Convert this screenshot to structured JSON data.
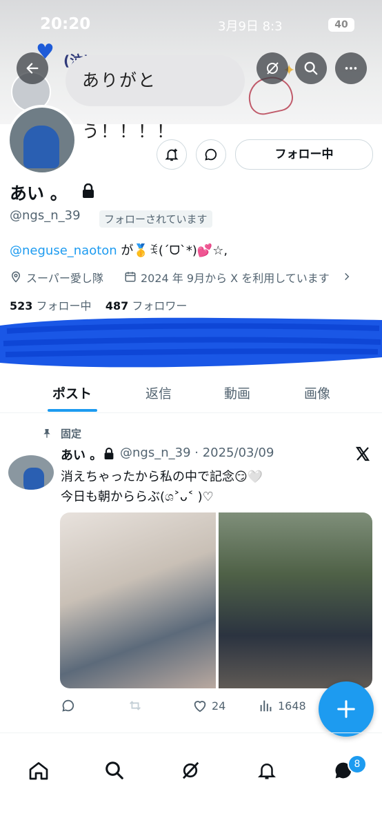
{
  "status_bar": {
    "time": "20:20",
    "date": "3月9日 8:3",
    "battery": "40"
  },
  "banner": {
    "bubble_text": "ありがとう！！！！",
    "crying_text": "(泣)"
  },
  "profile": {
    "follow_button": "フォロー中",
    "display_name": "あい 。",
    "handle": "@ngs_n_39",
    "follows_you": "フォローされています",
    "bio_mention": "@neguse_naoton",
    "bio_rest": " が🥇ꉂ(ˊᗜˋ*)💕☆,",
    "location": "スーパー愛し隊",
    "joined": "2024 年 9月から X を利用しています",
    "following_count": "523",
    "following_label": "フォロー中",
    "followers_count": "487",
    "followers_label": "フォロワー"
  },
  "tabs": [
    "ポスト",
    "返信",
    "動画",
    "画像"
  ],
  "post": {
    "pinned_label": "固定",
    "name": "あい 。",
    "handle_date": "@ngs_n_39 · 2025/03/09",
    "line1": "消えちゃったから私の中で記念😏🤍",
    "line2": "今日も朝かららぶ(ශ˃ᴗ˂ )♡",
    "likes": "24",
    "views": "1648"
  },
  "nav": {
    "messages_badge": "8"
  },
  "colors": {
    "accent": "#1d9bf0",
    "text": "#0f1419",
    "secondary": "#536471"
  }
}
